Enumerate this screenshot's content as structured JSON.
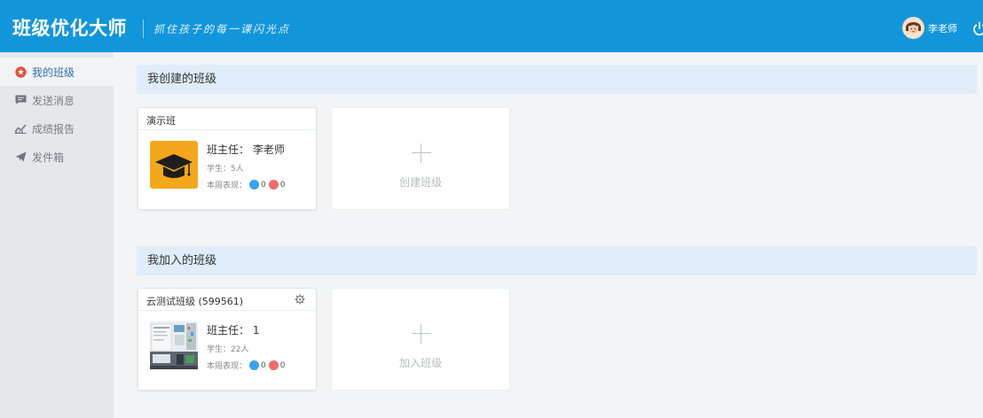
{
  "header": {
    "brand": "班级优化大师",
    "slogan": "抓住孩子的每一课闪光点",
    "user_name": "李老师",
    "power_icon": "power-icon"
  },
  "sidebar": {
    "items": [
      {
        "label": "我的班级",
        "icon": "badge-icon",
        "active": true
      },
      {
        "label": "发送消息",
        "icon": "message-icon",
        "active": false
      },
      {
        "label": "成绩报告",
        "icon": "chart-icon",
        "active": false
      },
      {
        "label": "发件箱",
        "icon": "send-icon",
        "active": false
      }
    ]
  },
  "created": {
    "header": "我创建的班级",
    "classes": [
      {
        "name": "演示班",
        "teacher": "班主任： 李老师",
        "students": "学生：5人",
        "perf_label": "本周表现：",
        "praise": "0",
        "criticism": "0",
        "thumb_icon": "graduation-cap-icon"
      }
    ],
    "action": "创建班级"
  },
  "joined": {
    "header": "我加入的班级",
    "classes": [
      {
        "name": "云测试班级 (599561)",
        "teacher": "班主任： 1",
        "students": "学生：22人",
        "perf_label": "本周表现：",
        "praise": "0",
        "criticism": "0",
        "settings_icon": "gear-icon"
      }
    ],
    "action": "加入班级"
  },
  "colors": {
    "topbar": "#1296db",
    "sidebar": "#e5e7ea",
    "section_header": "#deedf9",
    "active_text": "#2f6fb4",
    "praise": "#3aa2f0",
    "criticism": "#f06a6a",
    "thumb_bg": "#f4a71b"
  }
}
